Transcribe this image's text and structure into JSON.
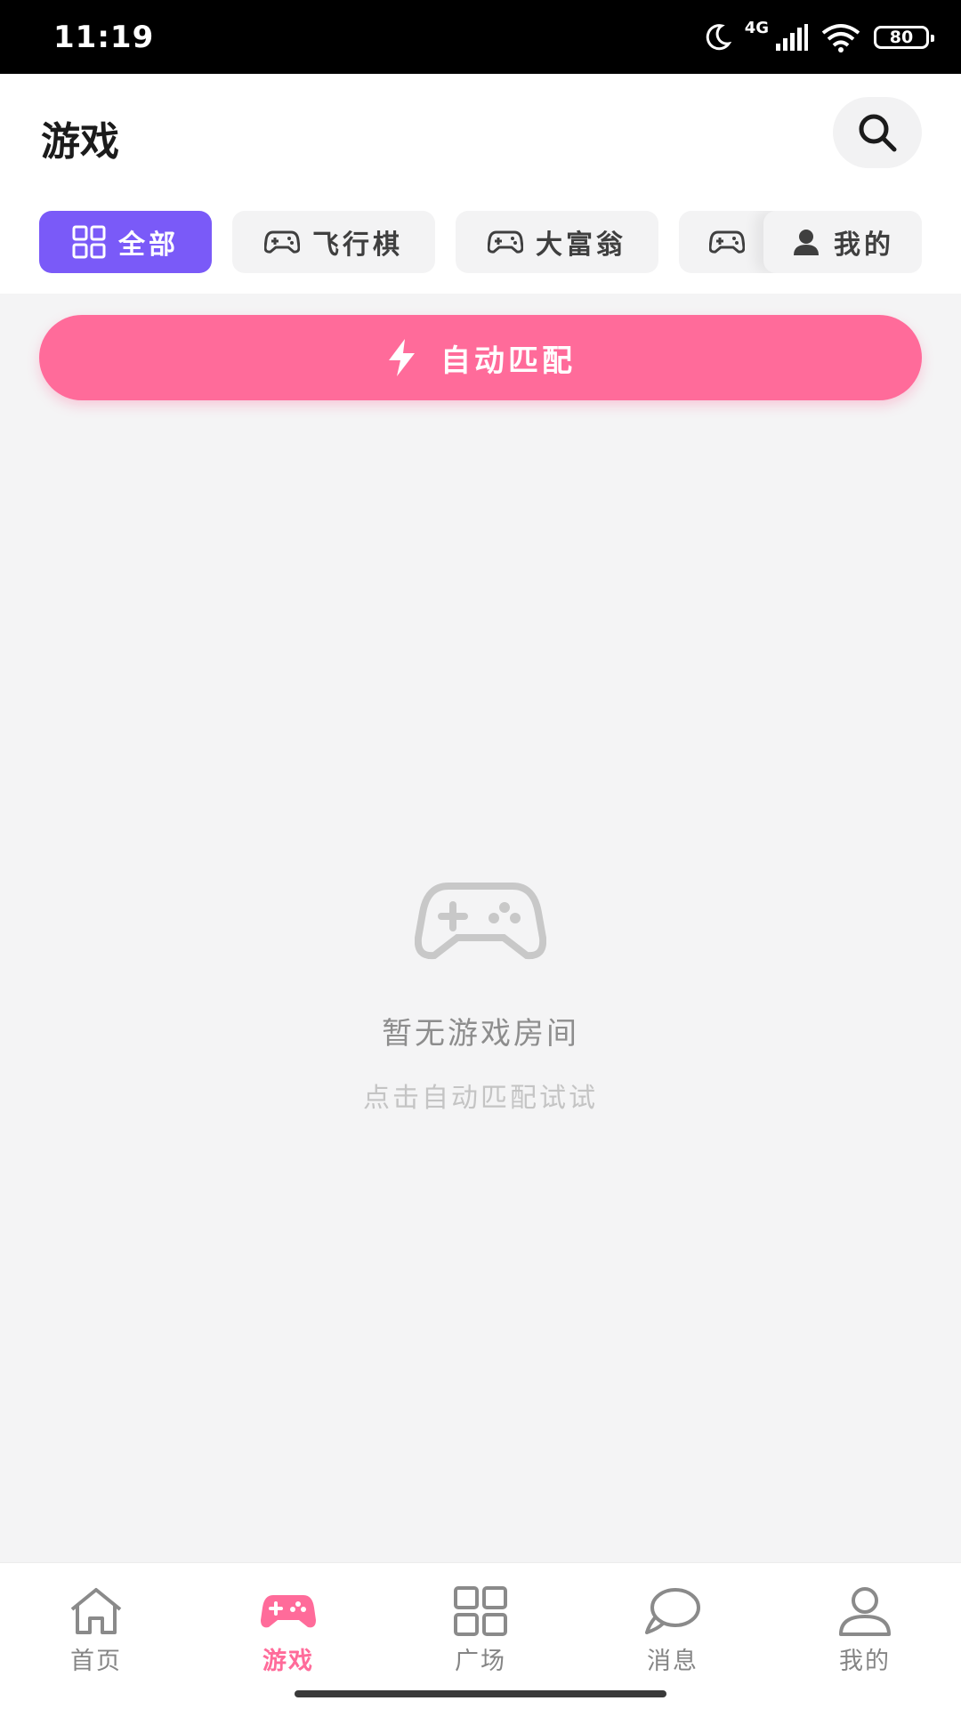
{
  "status_bar": {
    "time": "11:19",
    "network": "4G",
    "battery": "80"
  },
  "header": {
    "title": "游戏"
  },
  "tabs": [
    {
      "label": "全部",
      "icon": "grid-icon",
      "active": true
    },
    {
      "label": "飞行棋",
      "icon": "gamepad-icon",
      "active": false
    },
    {
      "label": "大富翁",
      "icon": "gamepad-icon",
      "active": false
    },
    {
      "label": "我的",
      "icon": "user-icon",
      "active": false
    }
  ],
  "match_button": {
    "label": "自动匹配",
    "icon": "lightning-icon"
  },
  "empty_state": {
    "icon": "gamepad-icon",
    "title": "暂无游戏房间",
    "subtitle": "点击自动匹配试试"
  },
  "bottom_nav": [
    {
      "label": "首页",
      "icon": "home-icon",
      "active": false
    },
    {
      "label": "游戏",
      "icon": "gamepad-icon",
      "active": true
    },
    {
      "label": "广场",
      "icon": "grid-icon",
      "active": false
    },
    {
      "label": "消息",
      "icon": "chat-icon",
      "active": false
    },
    {
      "label": "我的",
      "icon": "user-icon",
      "active": false
    }
  ],
  "colors": {
    "accent_purple": "#7a5af8",
    "accent_pink": "#ff6b9a",
    "background": "#f4f4f5"
  }
}
